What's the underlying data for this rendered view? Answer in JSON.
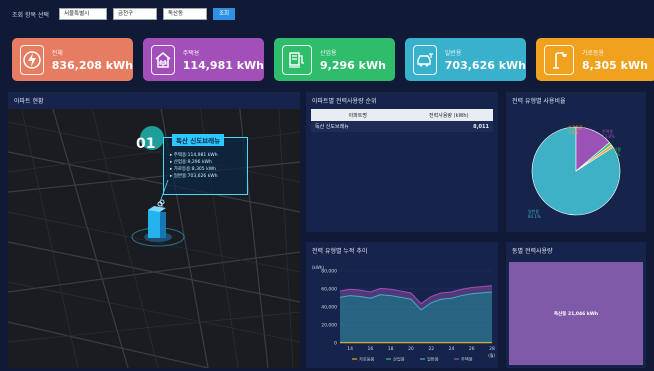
{
  "filters": {
    "region_label": "조회 항목 선택",
    "city": "서울특별시",
    "district": "금천구",
    "dong": "독산동",
    "search_button": "조회"
  },
  "cards": [
    {
      "name": "전체",
      "value": "836,208 kWh",
      "color": "#e67d63",
      "icon": "bolt-icon"
    },
    {
      "name": "주택용",
      "value": "114,981 kWh",
      "color": "#a34fba",
      "icon": "house-plug-icon"
    },
    {
      "name": "산업용",
      "value": "9,296 kWh",
      "color": "#2fbd6c",
      "icon": "charger-icon"
    },
    {
      "name": "일반용",
      "value": "703,626 kWh",
      "color": "#37b1cc",
      "icon": "electric-car-icon"
    },
    {
      "name": "가로등용",
      "value": "8,305 kWh",
      "color": "#f0a11e",
      "icon": "streetlight-icon"
    }
  ],
  "map_panel": {
    "title": "아파트 현황",
    "marker_number": "01",
    "popup_title": "독산 신도브래뉴",
    "popup_items": [
      "주택용:114,981 kWh",
      "산업용:9,296 kWh",
      "가로등용:8,305 kWh",
      "일반용:703,626 kWh"
    ]
  },
  "ranking_panel": {
    "title": "아파트별 전력사용량 순위",
    "columns": [
      "아파트명",
      "전력사용량 (kWh)"
    ],
    "rows": [
      [
        "독산 신도브래뉴",
        "8,011"
      ]
    ]
  },
  "pie_panel": {
    "title": "전력 유형별 사용비율"
  },
  "line_panel": {
    "title": "전력 유형별 누적 추이",
    "unit": "(kWh)",
    "x_unit": "(월)"
  },
  "treemap_panel": {
    "title": "동별 전력사용량",
    "label": "독산동 21,046 kWh",
    "color": "#7f5aa8"
  },
  "chart_data": [
    {
      "type": "pie",
      "slices": [
        {
          "name": "일반용",
          "value": 84.1,
          "label": "84.1%",
          "color": "#3eb1c6"
        },
        {
          "name": "주택용",
          "value": 13.8,
          "label": "13.8%",
          "color": "#9b52b6"
        },
        {
          "name": "산업용",
          "value": 1.1,
          "label": "1.1%",
          "color": "#3fbf77"
        },
        {
          "name": "가로등용",
          "value": 1.0,
          "label": "1.0%",
          "color": "#f2a32a"
        }
      ]
    },
    {
      "type": "area",
      "x": [
        13,
        14,
        15,
        16,
        17,
        18,
        19,
        20,
        21,
        22,
        23,
        24,
        25,
        26,
        27,
        28
      ],
      "xticks": [
        14,
        16,
        18,
        20,
        22,
        24,
        26,
        28
      ],
      "yticks": [
        0,
        20000,
        40000,
        60000,
        80000
      ],
      "ytick_labels": [
        "0",
        "20,000",
        "40,000",
        "60,000",
        "80,000"
      ],
      "ylim": [
        0,
        80000
      ],
      "series": [
        {
          "name": "가로등용",
          "color": "#f2a32a",
          "values": [
            300,
            300,
            300,
            300,
            300,
            300,
            300,
            300,
            300,
            300,
            300,
            300,
            300,
            300,
            300,
            300
          ]
        },
        {
          "name": "산업용",
          "color": "#3fbf77",
          "values": [
            400,
            400,
            400,
            400,
            400,
            400,
            400,
            400,
            400,
            400,
            400,
            400,
            400,
            400,
            400,
            400
          ]
        },
        {
          "name": "일반용",
          "color": "#3eb1c6",
          "values": [
            50000,
            52000,
            51000,
            49000,
            53000,
            52000,
            50000,
            48000,
            36000,
            44000,
            48000,
            49000,
            52000,
            54000,
            55000,
            56000
          ]
        },
        {
          "name": "주택용",
          "color": "#9b52b6",
          "values": [
            7000,
            7000,
            7000,
            7000,
            7000,
            7000,
            7000,
            7000,
            7000,
            7000,
            7000,
            7000,
            7000,
            7000,
            7000,
            7000
          ]
        }
      ]
    }
  ]
}
